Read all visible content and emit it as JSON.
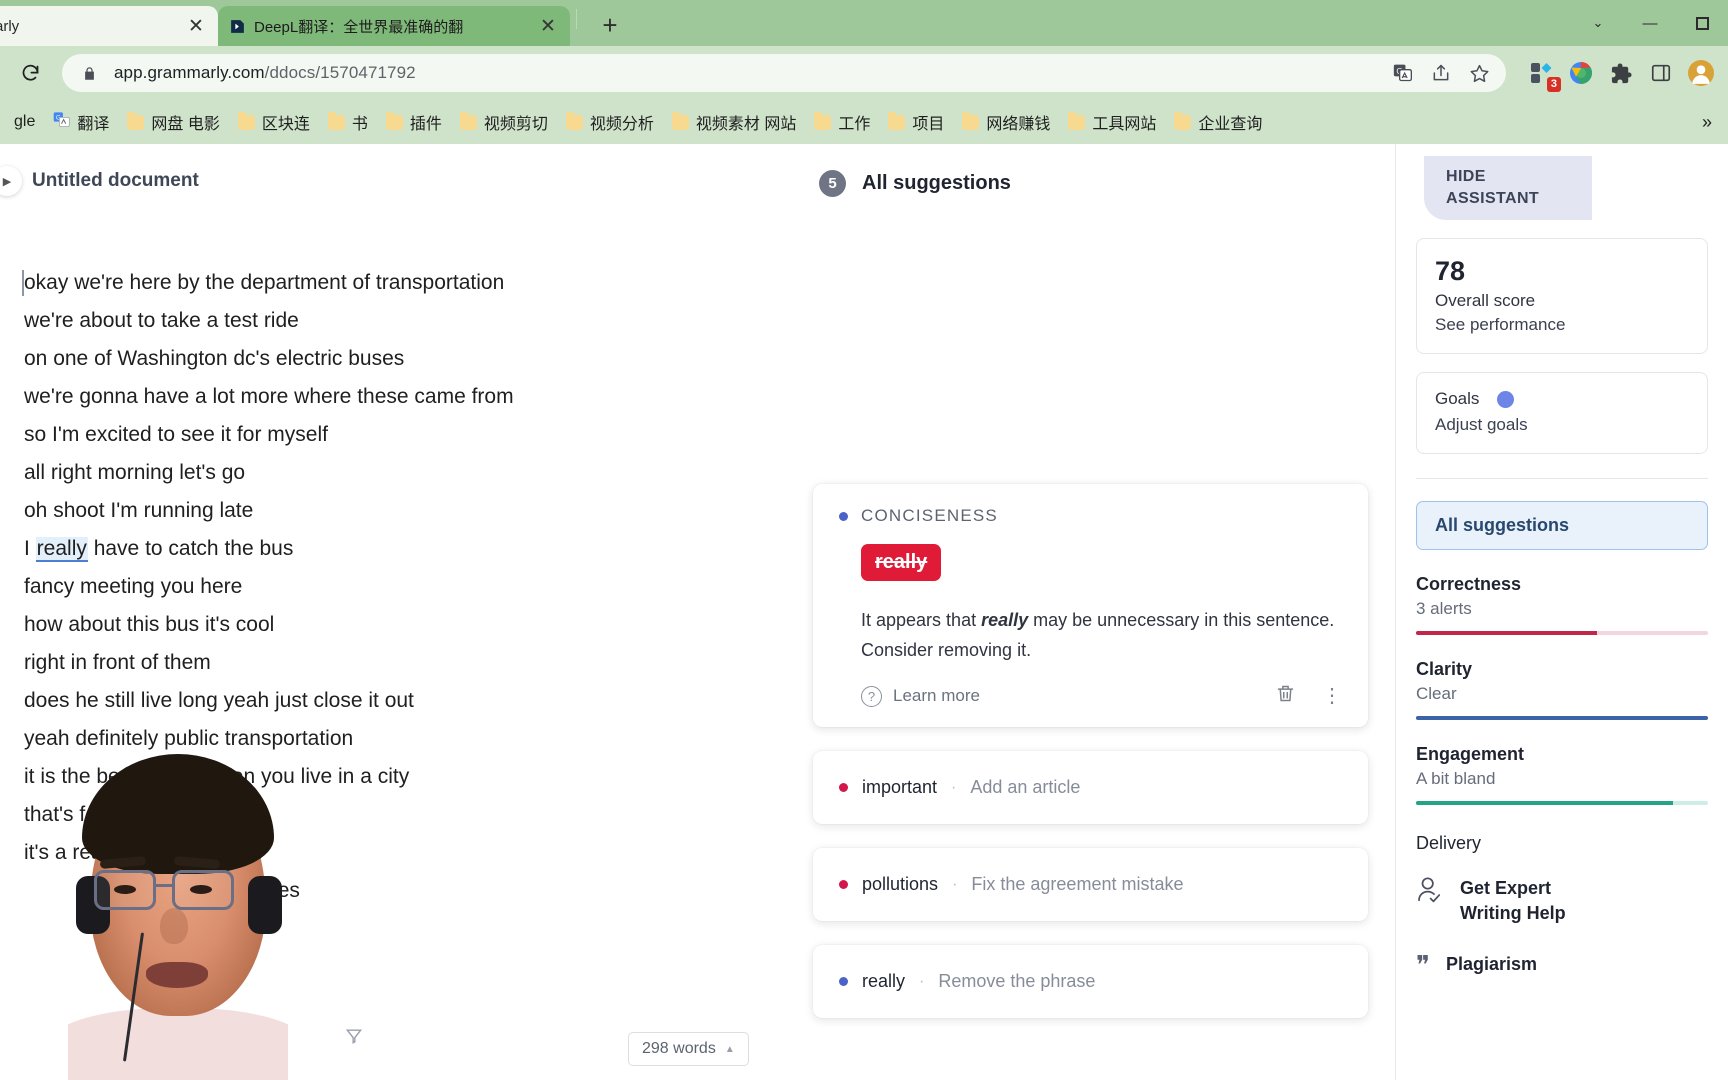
{
  "browser": {
    "tabs": [
      {
        "title": "mmarly",
        "favicon": "grammarly-icon",
        "active": false
      },
      {
        "title": "DeepL翻译：全世界最准确的翻",
        "favicon": "deepl-icon",
        "active": true
      }
    ],
    "new_tab_label": "+",
    "window_controls": {
      "chevron": "⌄",
      "minimize": "—",
      "maximize": "□"
    },
    "nav": {
      "reload_icon": "reload-icon",
      "lock_icon": "lock-icon",
      "url_domain": "app.grammarly.com",
      "url_path": "/ddocs/1570471792",
      "translate_icon": "translate-icon",
      "share_icon": "share-icon",
      "bookmark_icon": "star-icon",
      "extensions_icon": "extensions-icon",
      "extensions_badge": "3",
      "profile_icon": "profile-icon"
    },
    "bookmarks": [
      {
        "label": "gle",
        "icon": "none"
      },
      {
        "label": "翻译",
        "icon": "google-translate-icon"
      },
      {
        "label": "网盘 电影",
        "icon": "folder"
      },
      {
        "label": "区块连",
        "icon": "folder"
      },
      {
        "label": "书",
        "icon": "folder"
      },
      {
        "label": "插件",
        "icon": "folder"
      },
      {
        "label": "视频剪切",
        "icon": "folder"
      },
      {
        "label": "视频分析",
        "icon": "folder"
      },
      {
        "label": "视频素材 网站",
        "icon": "folder"
      },
      {
        "label": "工作",
        "icon": "folder"
      },
      {
        "label": "项目",
        "icon": "folder"
      },
      {
        "label": "网络赚钱",
        "icon": "folder"
      },
      {
        "label": "工具网站",
        "icon": "folder"
      },
      {
        "label": "企业查询",
        "icon": "folder"
      }
    ],
    "bookmarks_overflow": "»"
  },
  "editor": {
    "collapse_icon": "chevron-right-icon",
    "doc_title": "Untitled document",
    "lines": [
      "okay we're here by the department of transportation",
      "we're about to take a test ride",
      "on one of Washington dc's electric buses",
      "we're gonna have a lot more where these came from",
      "so I'm excited to see it for myself",
      "all right morning let's go",
      "oh shoot I'm running late",
      "fancy meeting you here",
      "how about this bus it's cool",
      "right in front of them",
      "does he still live long yeah just close it out",
      "yeah definitely public transportation",
      "it is the best option when you live in a city",
      "that's fo",
      "it's a really big part of",
      "daily commutes"
    ],
    "highlight_line": {
      "prefix": "I ",
      "highlight": "really",
      "suffix": " have to catch the bus"
    },
    "word_count": "298 words",
    "word_count_caret": "▲",
    "clear_formatting_icon": "clear-formatting-icon"
  },
  "suggestions_header": {
    "badge": "5",
    "title": "All suggestions"
  },
  "active_card": {
    "category": "CONCISENESS",
    "category_color": "#4b62c9",
    "chip_text": "really",
    "chip_color": "#e01b38",
    "explanation_prefix": "It appears that ",
    "explanation_bold": "really",
    "explanation_suffix": " may be unnecessary in this sentence. Consider removing it.",
    "learn_more": "Learn more",
    "help_icon": "question-circle-icon",
    "delete_icon": "trash-icon",
    "more_icon": "more-vertical-icon"
  },
  "mini_cards": [
    {
      "word": "important",
      "separator": "·",
      "action": "Add an article",
      "dot_color": "#d4174a"
    },
    {
      "word": "pollutions",
      "separator": "·",
      "action": "Fix the agreement mistake",
      "dot_color": "#d4174a"
    },
    {
      "word": "really",
      "separator": "·",
      "action": "Remove the phrase",
      "dot_color": "#4b62c9"
    }
  ],
  "assistant": {
    "hide_label_line1": "HIDE",
    "hide_label_line2": "ASSISTANT",
    "score": {
      "value": "78",
      "label": "Overall score",
      "sub": "See performance"
    },
    "goals": {
      "title": "Goals",
      "sub": "Adjust goals",
      "dot_color": "#6e85e8"
    },
    "all_suggestions_button": "All suggestions",
    "metrics": [
      {
        "name": "Correctness",
        "value": "3 alerts",
        "color": "#c2264b",
        "track": "#f3d6dd",
        "fill": 62
      },
      {
        "name": "Clarity",
        "value": "Clear",
        "color": "#3c63a8",
        "track": "#d8e2f2",
        "fill": 100
      },
      {
        "name": "Engagement",
        "value": "A bit bland",
        "color": "#24a387",
        "track": "#cdeee6",
        "fill": 88
      }
    ],
    "delivery_label": "Delivery",
    "expert": {
      "icon": "person-check-icon",
      "line1": "Get Expert",
      "line2": "Writing Help"
    },
    "plagiarism": {
      "icon": "quotes-icon",
      "label": "Plagiarism"
    }
  }
}
